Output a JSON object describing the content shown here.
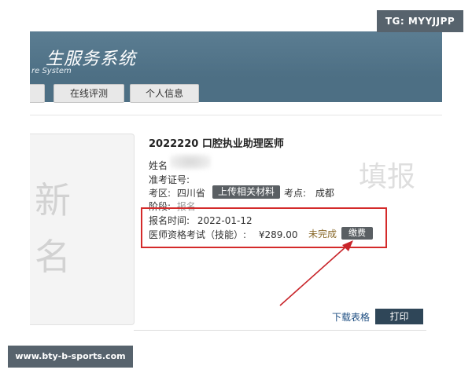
{
  "watermarks": {
    "top_right": "TG: MYYJJPP",
    "bottom_left": "www.bty-b-sports.com"
  },
  "header": {
    "title": "生服务系统",
    "subtitle": "re System"
  },
  "nav": {
    "items": [
      {
        "label": ""
      },
      {
        "label": "在线评测"
      },
      {
        "label": "个人信息"
      }
    ]
  },
  "left_card": {
    "chars": [
      "新",
      "名"
    ]
  },
  "right_watermark": "填报",
  "exam": {
    "title": "2022220 口腔执业助理医师",
    "name_label": "姓名",
    "cert_label": "准考证号:",
    "region_label": "考区:",
    "region_value": "四川省",
    "upload_button": "上传相关材料",
    "site_label": "考点:",
    "site_value": "成都",
    "stage_label": "阶段:",
    "stage_value": "报名",
    "signup_time_label": "报名时间:",
    "signup_time_value": "2022-01-12",
    "exam_item_label": "医师资格考试（技能）:",
    "price": "¥289.00",
    "status": "未完成",
    "pay_button": "缴费"
  },
  "actions": {
    "download": "下载表格",
    "print": "打印"
  },
  "colors": {
    "banner": "#4e7085",
    "highlight": "#d42a2a",
    "print_button": "#2f4658",
    "status": "#8a6a2b"
  }
}
